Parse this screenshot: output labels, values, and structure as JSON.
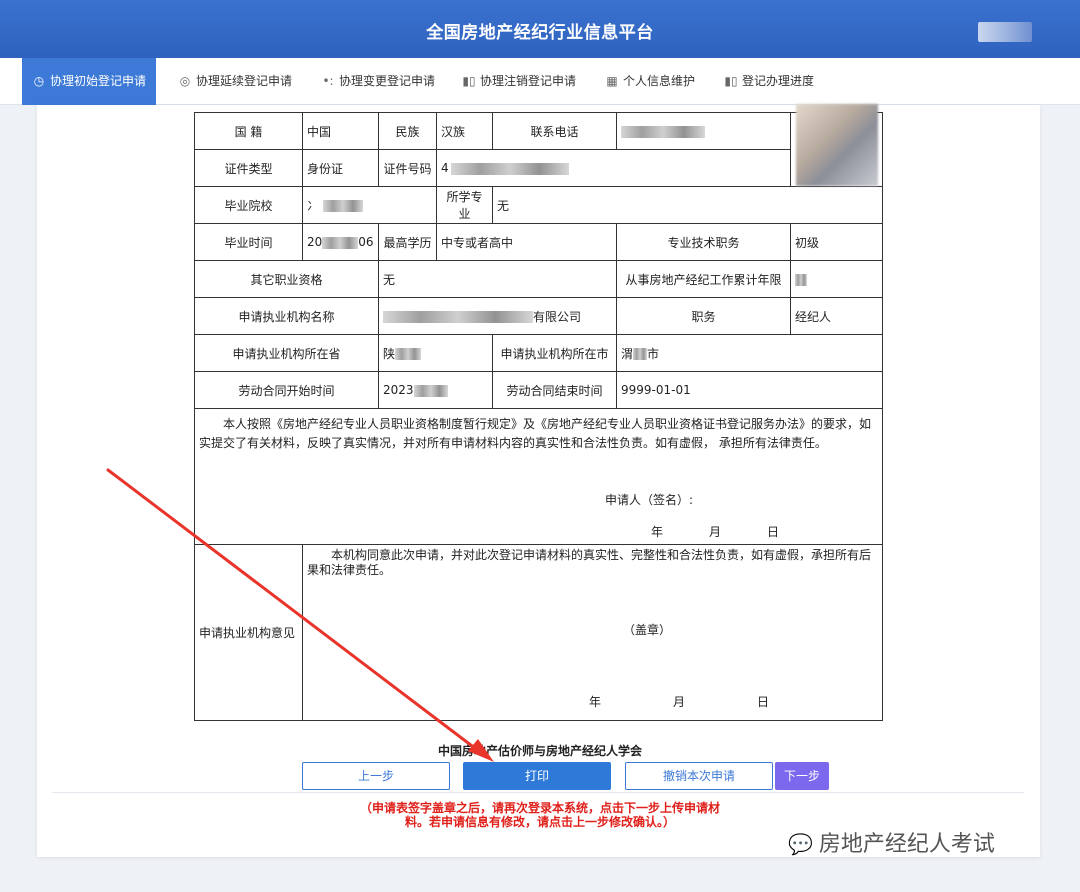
{
  "header": {
    "title": "全国房地产经纪行业信息平台"
  },
  "nav": [
    {
      "label": "协理初始登记申请",
      "icon": "clock-icon",
      "active": true
    },
    {
      "label": "协理延续登记申请",
      "icon": "target-icon"
    },
    {
      "label": "协理变更登记申请",
      "icon": "dots-icon"
    },
    {
      "label": "协理注销登记申请",
      "icon": "card-icon"
    },
    {
      "label": "个人信息维护",
      "icon": "grid-icon"
    },
    {
      "label": "登记办理进度",
      "icon": "card-icon"
    }
  ],
  "form": {
    "nationality_label": "国  籍",
    "nationality": "中国",
    "ethnicity_label": "民族",
    "ethnicity": "汉族",
    "phone_label": "联系电话",
    "id_type_label": "证件类型",
    "id_type": "身份证",
    "id_number_label": "证件号码",
    "id_number": "4",
    "school_label": "毕业院校",
    "school": "冫",
    "major_label": "所学专业",
    "major": "无",
    "grad_time_label": "毕业时间",
    "grad_time_prefix": "20",
    "grad_time_suffix": "06",
    "education_label": "最高学历",
    "education": "中专或者高中",
    "title_label": "专业技术职务",
    "title": "初级",
    "other_cert_label": "其它职业资格",
    "other_cert": "无",
    "years_label": "从事房地产经纪工作累计年限",
    "org_label": "申请执业机构名称",
    "org_suffix": "有限公司",
    "position_label": "职务",
    "position": "经纪人",
    "province_label": "申请执业机构所在省",
    "province": "陕",
    "city_label": "申请执业机构所在市",
    "city": "渭",
    "city_suffix": "市",
    "contract_start_label": "劳动合同开始时间",
    "contract_start": "2023",
    "contract_end_label": "劳动合同结束时间",
    "contract_end": "9999-01-01",
    "declaration": "本人按照《房地产经纪专业人员职业资格制度暂行规定》及《房地产经纪专业人员职业资格证书登记服务办法》的要求，如实提交了有关材料，反映了真实情况，并对所有申请材料内容的真实性和合法性负责。如有虚假， 承担所有法律责任。",
    "applicant_sign": "申请人（签名）:",
    "date_year": "年",
    "date_month": "月",
    "date_day": "日",
    "opinion_label": "申请执业机构意见",
    "opinion_text": "本机构同意此次申请，并对此次登记申请材料的真实性、完整性和合法性负责，如有虚假，承担所有后果和法律责任。",
    "seal": "（盖章）"
  },
  "footer": {
    "org_name": "中国房地产估价师与房地产经纪人学会",
    "prev_button": "上一步",
    "print_button": "打印",
    "cancel_button": "撤销本次申请",
    "next_button": "下一步",
    "notice_line1": "（申请表签字盖章之后，请再次登录本系统，点击下一步上传申请材",
    "notice_line2": "料。若申请信息有修改，请点击上一步修改确认。）"
  },
  "watermark": {
    "text": "房地产经纪人考试",
    "icon": "wechat-icon"
  },
  "colors": {
    "header": "#3b72cf",
    "active_nav": "#3d79d6",
    "primary": "#2f7ad8",
    "next": "#7b68ee",
    "notice": "#e0201b",
    "arrow": "#e8342a"
  }
}
